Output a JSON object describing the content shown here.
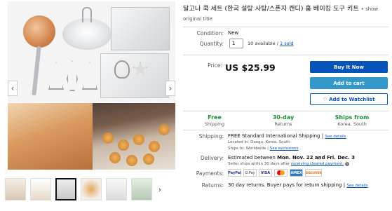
{
  "listing": {
    "title": "달고나 쿡 세트 (한국 설탕 사탕/스폰지 캔디) 홈 베이킹 도구 키트",
    "show_original_title": "show original title"
  },
  "gallery": {
    "prev": "‹",
    "next": "›",
    "thumb_next": "›"
  },
  "condition": {
    "label": "Condition:",
    "value": "New"
  },
  "quantity": {
    "label": "Quantity:",
    "value": "1",
    "available": "10 available /",
    "sold": "1 sold"
  },
  "price": {
    "label": "Price:",
    "value": "US $25.99"
  },
  "actions": {
    "buy_now": "Buy It Now",
    "add_to_cart": "Add to cart",
    "watchlist": "♡ Add to Watchlist"
  },
  "features": [
    {
      "title": "Free",
      "sub": "Shipping"
    },
    {
      "title": "30-day",
      "sub": "Returns"
    },
    {
      "title": "Ships from",
      "sub": "Korea, South"
    }
  ],
  "shipping": {
    "label": "Shipping:",
    "value": "FREE  Standard International Shipping |",
    "details_link": "See details",
    "located": "Located in:  Daegu, Korea, South",
    "ships_to": "Ships to:  Worldwide",
    "exclusions_link": "See exclusions"
  },
  "delivery": {
    "label": "Delivery:",
    "prefix": "Estimated between",
    "dates": "Mon. Nov. 22 and Fri. Dec. 3",
    "note": "Seller ships within 30 days after",
    "note_link": "receiving cleared payment."
  },
  "payments": {
    "label": "Payments:",
    "methods": [
      "PayPal",
      "G Pay",
      "VISA",
      "MC",
      "AMEX",
      "DISCOVER"
    ]
  },
  "returns": {
    "label": "Returns:",
    "value": "30 day returns. Buyer pays for return shipping |",
    "details_link": "See details"
  },
  "colors": {
    "buy_now": "#0654ba",
    "add_to_cart": "#3498ca",
    "feature_green": "#1e8c3a",
    "link": "#0654ba"
  }
}
